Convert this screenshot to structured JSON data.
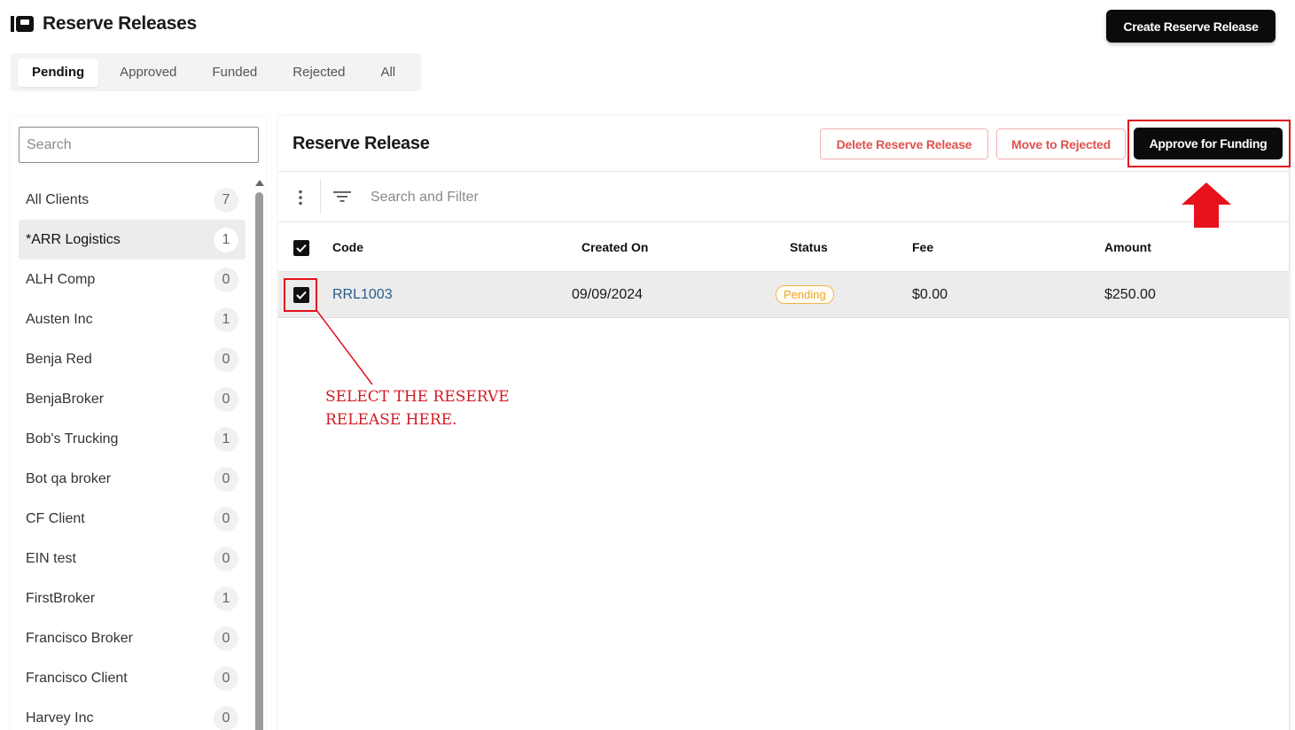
{
  "header": {
    "title": "Reserve Releases",
    "create_button": "Create Reserve Release"
  },
  "tabs": [
    {
      "label": "Pending",
      "active": true
    },
    {
      "label": "Approved",
      "active": false
    },
    {
      "label": "Funded",
      "active": false
    },
    {
      "label": "Rejected",
      "active": false
    },
    {
      "label": "All",
      "active": false
    }
  ],
  "sidebar": {
    "search_placeholder": "Search",
    "clients": [
      {
        "name": "All Clients",
        "count": "7"
      },
      {
        "name": "*ARR Logistics",
        "count": "1",
        "active": true
      },
      {
        "name": "ALH Comp",
        "count": "0"
      },
      {
        "name": "Austen Inc",
        "count": "1"
      },
      {
        "name": "Benja Red",
        "count": "0"
      },
      {
        "name": "BenjaBroker",
        "count": "0"
      },
      {
        "name": "Bob's Trucking",
        "count": "1"
      },
      {
        "name": "Bot qa broker",
        "count": "0"
      },
      {
        "name": "CF Client",
        "count": "0"
      },
      {
        "name": "EIN test",
        "count": "0"
      },
      {
        "name": "FirstBroker",
        "count": "1"
      },
      {
        "name": "Francisco Broker",
        "count": "0"
      },
      {
        "name": "Francisco Client",
        "count": "0"
      },
      {
        "name": "Harvey Inc",
        "count": "0"
      }
    ]
  },
  "main": {
    "title": "Reserve Release",
    "delete_button": "Delete Reserve Release",
    "reject_button": "Move to Rejected",
    "approve_button": "Approve for Funding",
    "filter_placeholder": "Search and Filter",
    "columns": {
      "code": "Code",
      "created_on": "Created On",
      "status": "Status",
      "fee": "Fee",
      "amount": "Amount"
    },
    "rows": [
      {
        "code": "RRL1003",
        "created_on": "09/09/2024",
        "status": "Pending",
        "fee": "$0.00",
        "amount": "$250.00",
        "selected": true
      }
    ]
  },
  "annotation": {
    "text": "SELECT THE RESERVE\nRELEASE HERE.",
    "color": "#e3131c"
  },
  "colors": {
    "primary_button": "#0b0b0b",
    "danger_text": "#e0524f",
    "pending_status": "#f0a326",
    "link": "#2b5a8a"
  }
}
